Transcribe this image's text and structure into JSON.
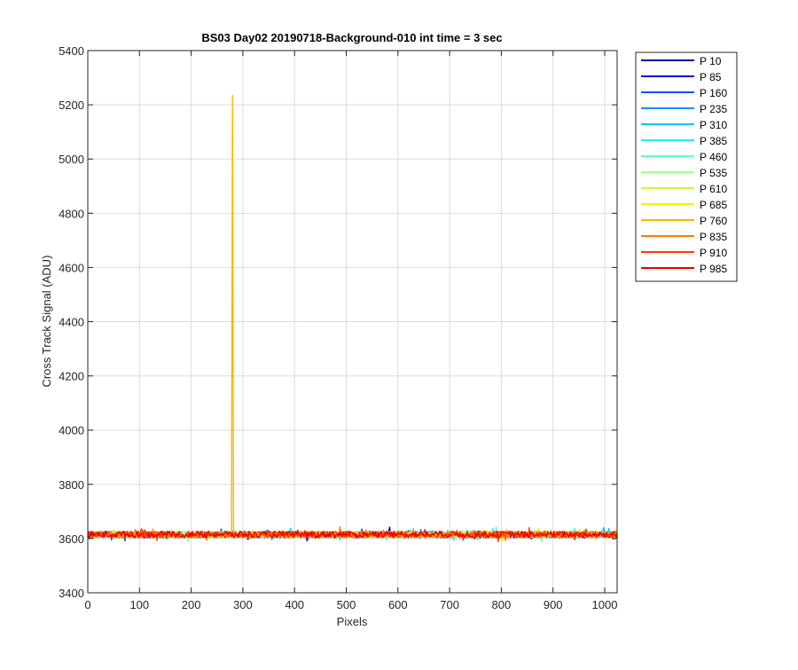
{
  "chart_data": {
    "type": "line",
    "title": "BS03 Day02 20190718-Background-010 int time = 3 sec",
    "xlabel": "Pixels",
    "ylabel": "Cross Track Signal (ADU)",
    "xlim": [
      0,
      1024
    ],
    "ylim": [
      3400,
      5400
    ],
    "xticks": [
      0,
      100,
      200,
      300,
      400,
      500,
      600,
      700,
      800,
      900,
      1000
    ],
    "yticks": [
      3400,
      3600,
      3800,
      4000,
      4200,
      4400,
      4600,
      4800,
      5000,
      5200,
      5400
    ],
    "grid": true,
    "legend_position": "outside-top-right",
    "baseline_level": 3615,
    "noise_amplitude": 12,
    "series": [
      {
        "name": "P 10",
        "color": "#0000b0"
      },
      {
        "name": "P 85",
        "color": "#0010e0"
      },
      {
        "name": "P 160",
        "color": "#0050ff"
      },
      {
        "name": "P 235",
        "color": "#0090ff"
      },
      {
        "name": "P 310",
        "color": "#00c8ff"
      },
      {
        "name": "P 385",
        "color": "#20f0f0"
      },
      {
        "name": "P 460",
        "color": "#60ffc0"
      },
      {
        "name": "P 535",
        "color": "#a0ff90"
      },
      {
        "name": "P 610",
        "color": "#d8f040"
      },
      {
        "name": "P 685",
        "color": "#ffee00"
      },
      {
        "name": "P 760",
        "color": "#f5b800",
        "spike": {
          "x": 280,
          "y": 5235
        }
      },
      {
        "name": "P 835",
        "color": "#ff7a00"
      },
      {
        "name": "P 910",
        "color": "#ff3a00"
      },
      {
        "name": "P 985",
        "color": "#ee0000"
      }
    ]
  }
}
